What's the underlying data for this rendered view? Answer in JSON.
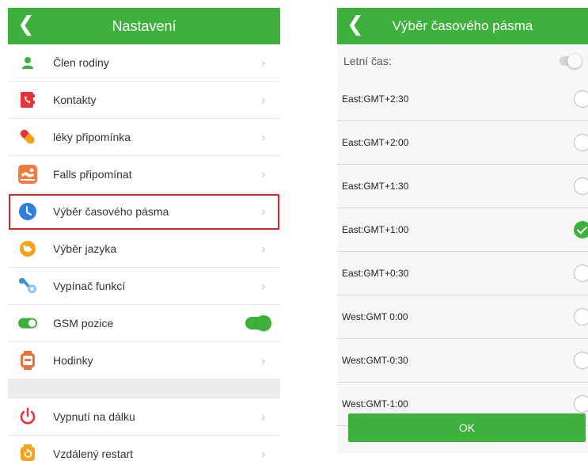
{
  "left": {
    "title": "Nastavení",
    "back": "❮",
    "chevron": "›",
    "items": [
      {
        "label": "Člen rodiny"
      },
      {
        "label": "Kontakty"
      },
      {
        "label": "léky připomínka"
      },
      {
        "label": "Falls připomínat"
      },
      {
        "label": "Výběr časového pásma"
      },
      {
        "label": "Výběr jazyka"
      },
      {
        "label": "Vypínač funkcí"
      },
      {
        "label": "GSM pozice"
      },
      {
        "label": "Hodinky"
      }
    ],
    "items2": [
      {
        "label": "Vypnutí na dálku"
      },
      {
        "label": "Vzdálený restart"
      }
    ]
  },
  "right": {
    "title": "Výběr časového pásma",
    "back": "❮",
    "summer_time_label": "Letní čas:",
    "zones": [
      {
        "label": "East:GMT+2:30",
        "checked": false
      },
      {
        "label": "East:GMT+2:00",
        "checked": false
      },
      {
        "label": "East:GMT+1:30",
        "checked": false
      },
      {
        "label": "East:GMT+1:00",
        "checked": true
      },
      {
        "label": "East:GMT+0:30",
        "checked": false
      },
      {
        "label": "West:GMT 0:00",
        "checked": false
      },
      {
        "label": "West:GMT-0:30",
        "checked": false
      },
      {
        "label": "West:GMT-1:00",
        "checked": false
      }
    ],
    "ok_label": "OK"
  },
  "colors": {
    "accent": "#3db13c",
    "highlight": "#d6262b"
  }
}
